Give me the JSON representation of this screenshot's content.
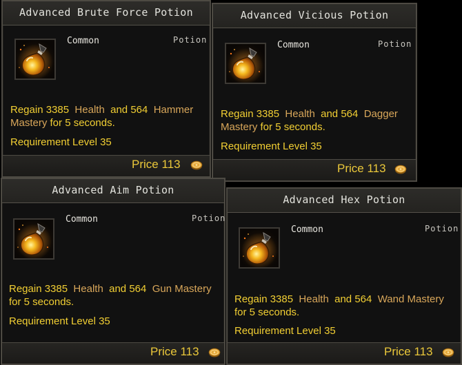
{
  "colors": {
    "panel_bg": "#111111",
    "header_bg": "#2a2926",
    "border": "#4d4a43",
    "title_text": "#e3e3dd",
    "stat_text": "#f2cf33",
    "highlight_text": "#d9a75a",
    "price_text": "#ebc83a"
  },
  "tooltips": [
    {
      "title": "Advanced Brute Force Potion",
      "rarity": "Common",
      "item_type": "Potion",
      "icon": "potion-flask-icon",
      "desc": {
        "regain": "Regain 3385",
        "stat": "Health",
        "and": "and 564",
        "mastery_a": "Hammer",
        "mastery_b": "Mastery",
        "duration": "for  5 seconds."
      },
      "requirement": "Requirement Level 35",
      "price": "Price 113",
      "currency_icon": "gold-coin-icon"
    },
    {
      "title": "Advanced Vicious Potion",
      "rarity": "Common",
      "item_type": "Potion",
      "icon": "potion-flask-icon",
      "desc": {
        "regain": "Regain 3385",
        "stat": "Health",
        "and": "and 564",
        "mastery_a": "Dagger",
        "mastery_b": "Mastery",
        "duration": "for  5 seconds."
      },
      "requirement": "Requirement Level 35",
      "price": "Price 113",
      "currency_icon": "gold-coin-icon"
    },
    {
      "title": "Advanced Aim Potion",
      "rarity": "Common",
      "item_type": "Potion",
      "icon": "potion-flask-icon",
      "desc": {
        "regain": "Regain 3385",
        "stat": "Health",
        "and": "and 564",
        "mastery": "Gun Mastery",
        "duration": "for  5 seconds."
      },
      "requirement": "Requirement Level 35",
      "price": "Price 113",
      "currency_icon": "gold-coin-icon"
    },
    {
      "title": "Advanced Hex Potion",
      "rarity": "Common",
      "item_type": "Potion",
      "icon": "potion-flask-icon",
      "desc": {
        "regain": "Regain 3385",
        "stat": "Health",
        "and": "and 564",
        "mastery": "Wand Mastery",
        "duration": "for  5 seconds."
      },
      "requirement": "Requirement Level 35",
      "price": "Price 113",
      "currency_icon": "gold-coin-icon"
    }
  ]
}
